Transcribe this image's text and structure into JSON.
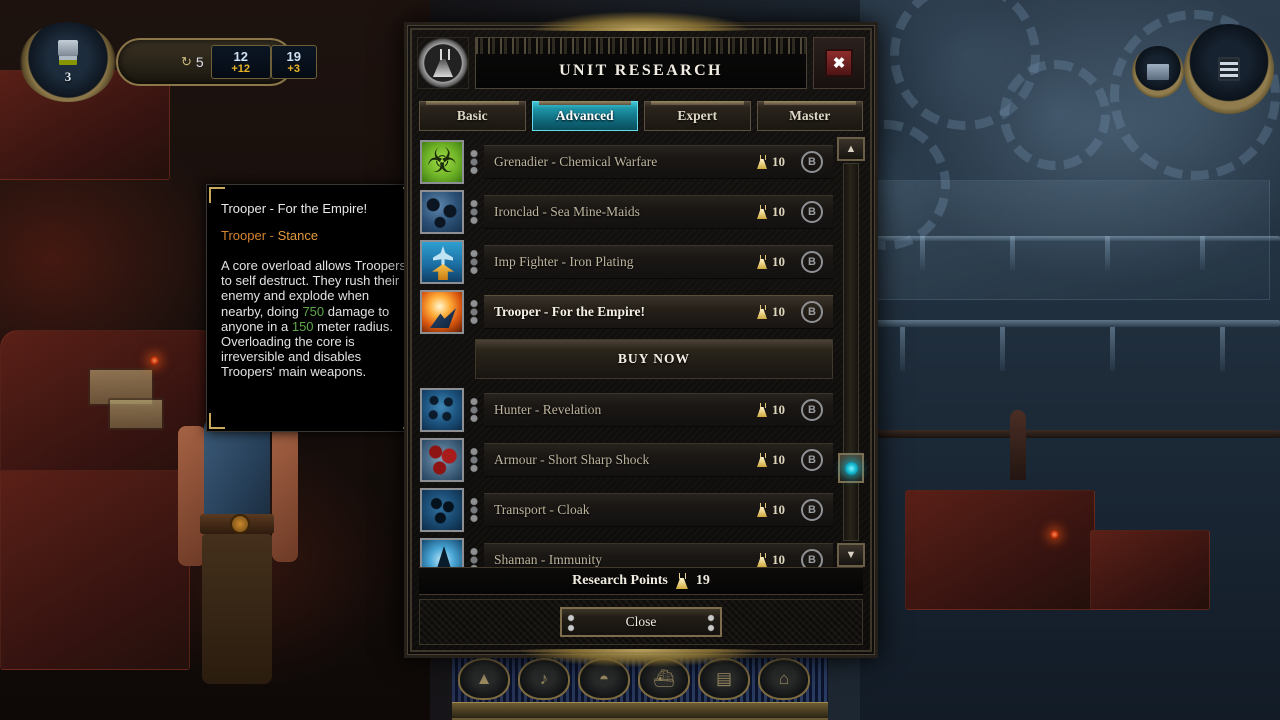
{
  "hud": {
    "rank": "3",
    "counter": "5",
    "counter_icon": "refresh-icon",
    "resource": {
      "icon": "ore-icon",
      "value": "12",
      "delta": "+12"
    },
    "research": {
      "icon": "flask-icon",
      "value": "19",
      "delta": "+3"
    },
    "right_buttons": [
      {
        "name": "map-button",
        "icon": "banner-icon"
      },
      {
        "name": "menu-button",
        "icon": "list-icon"
      }
    ],
    "bottom_toolbar": [
      {
        "name": "build-unit-1",
        "icon": "▲"
      },
      {
        "name": "build-unit-2",
        "icon": "♪"
      },
      {
        "name": "build-unit-3",
        "icon": "◓"
      },
      {
        "name": "build-unit-4",
        "icon": "⛴"
      },
      {
        "name": "build-unit-5",
        "icon": "▤"
      },
      {
        "name": "build-unit-6",
        "icon": "⌂"
      }
    ]
  },
  "dialog": {
    "title": "UNIT RESEARCH",
    "title_icon": "flask-icon",
    "close_x": "✖",
    "tabs": [
      {
        "label": "Basic",
        "active": false
      },
      {
        "label": "Advanced",
        "active": true
      },
      {
        "label": "Expert",
        "active": false
      },
      {
        "label": "Master",
        "active": false
      }
    ],
    "rows": [
      {
        "label": "Grenadier - Chemical Warfare",
        "cost": "10",
        "cost_icon": "flask-icon",
        "buy_icon": "B",
        "art": "a-bio",
        "selected": false
      },
      {
        "label": "Ironclad - Sea Mine-Maids",
        "cost": "10",
        "cost_icon": "flask-icon",
        "buy_icon": "B",
        "art": "a-sea",
        "selected": false
      },
      {
        "label": "Imp Fighter - Iron Plating",
        "cost": "10",
        "cost_icon": "flask-icon",
        "buy_icon": "B",
        "art": "a-fighter",
        "selected": false
      },
      {
        "label": "Trooper - For the Empire!",
        "cost": "10",
        "cost_icon": "flask-icon",
        "buy_icon": "B",
        "art": "a-boom",
        "selected": true
      },
      {
        "label": "Hunter - Revelation",
        "cost": "10",
        "cost_icon": "flask-icon",
        "buy_icon": "B",
        "art": "a-hunter",
        "selected": false
      },
      {
        "label": "Armour - Short Sharp Shock",
        "cost": "10",
        "cost_icon": "flask-icon",
        "buy_icon": "B",
        "art": "a-armour",
        "selected": false
      },
      {
        "label": "Transport - Cloak",
        "cost": "10",
        "cost_icon": "flask-icon",
        "buy_icon": "B",
        "art": "a-transport",
        "selected": false
      },
      {
        "label": "Shaman - Immunity",
        "cost": "10",
        "cost_icon": "flask-icon",
        "buy_icon": "B",
        "art": "a-shaman",
        "selected": false
      }
    ],
    "buy_now_label": "BUY NOW",
    "buy_now_after_row": 3,
    "scrollbar": {
      "up_icon": "▲",
      "down_icon": "▼",
      "thumb_icon": "orb-icon"
    },
    "research_points_label": "Research Points",
    "research_points_value": "19",
    "close_label": "Close"
  },
  "tooltip": {
    "title": "Trooper - For the Empire!",
    "category": "Trooper",
    "category_sep": "-",
    "subtype": "Stance",
    "desc_1": "A core overload allows Troopers to self destruct. They rush their enemy and explode when nearby, doing ",
    "damage": "750",
    "desc_2": " damage to anyone in a ",
    "radius": "150",
    "desc_3": " meter radius. Overloading the core is irreversible and disables Troopers' main weapons."
  },
  "colors": {
    "accent_teal": "#1d94a6",
    "gold": "#c9a95e",
    "orange": "#d4852f",
    "green": "#5fa84a",
    "close_red": "#8e2d2d"
  }
}
